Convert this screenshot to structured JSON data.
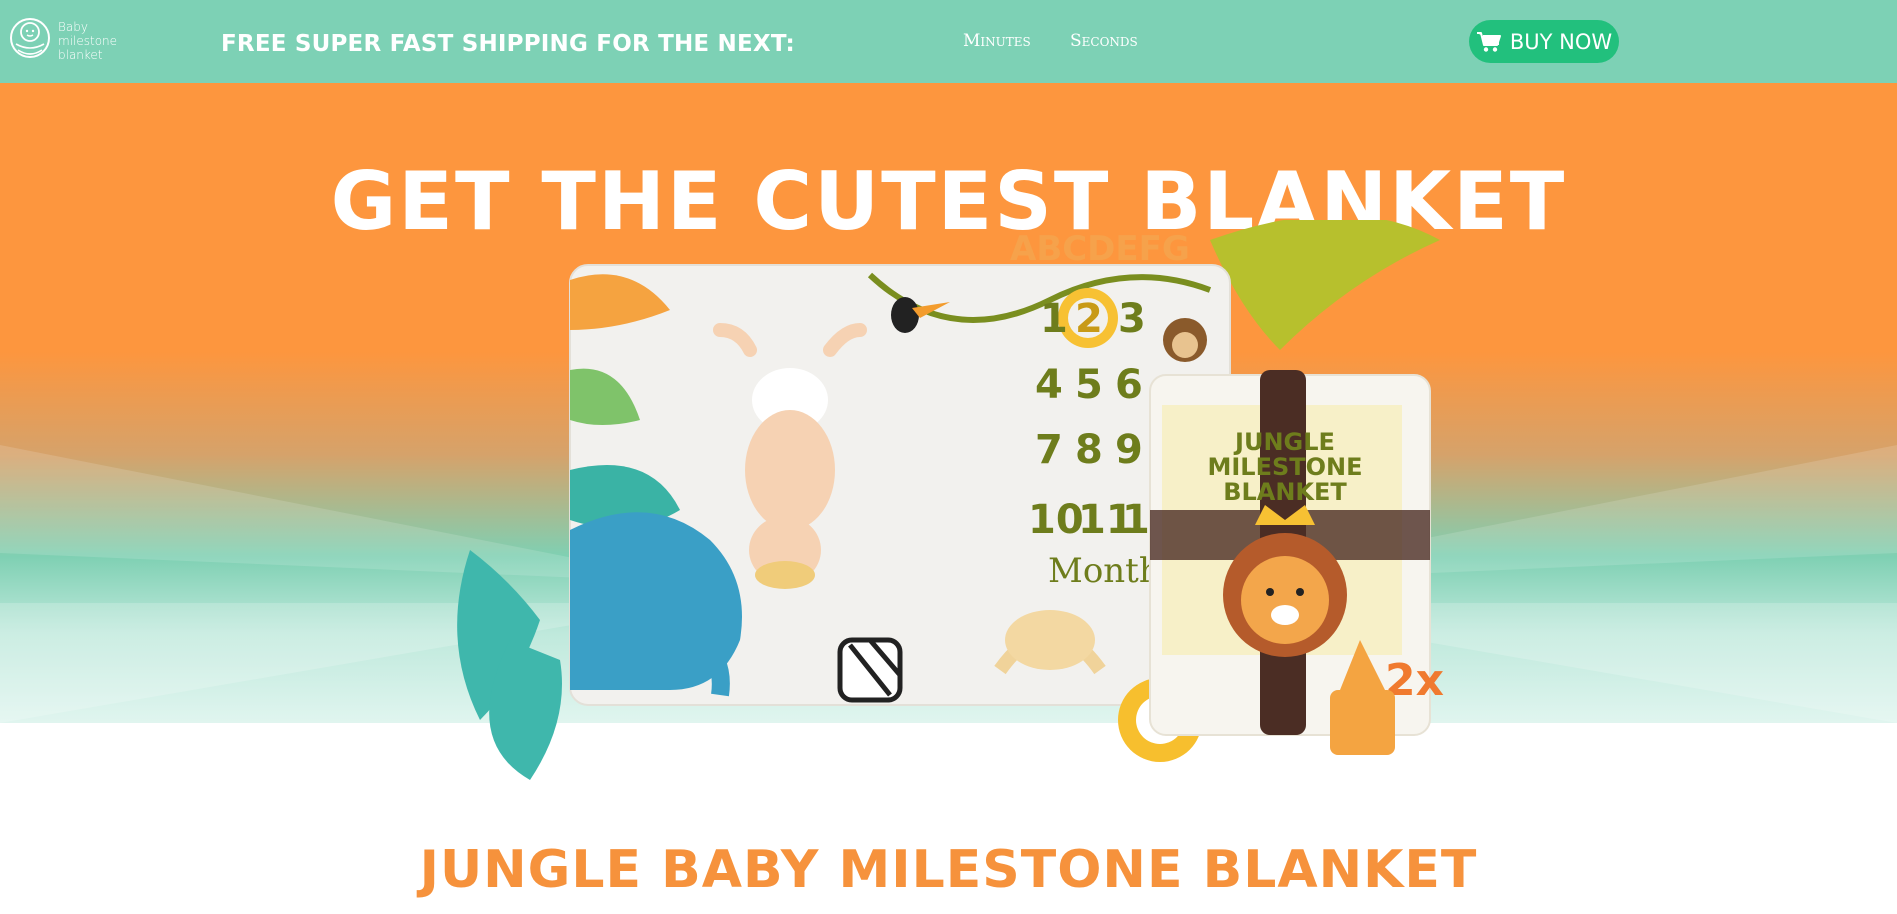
{
  "header": {
    "logo": {
      "line1": "Baby",
      "line2": "milestone",
      "line3": "blanket"
    },
    "promo_text": "FREE SUPER FAST SHIPPING FOR THE NEXT:",
    "timer": {
      "minutes_label": "Minutes",
      "seconds_label": "Seconds"
    },
    "buy_button": {
      "label": "BUY NOW",
      "icon": "cart-icon"
    }
  },
  "hero": {
    "title": "GET THE CUTEST BLANKET",
    "image": {
      "blanket_letters": "ABCDEFG",
      "numbers": [
        "1",
        "2",
        "3",
        "4",
        "5",
        "6",
        "7",
        "8",
        "9",
        "10",
        "11",
        "12"
      ],
      "months_label": "Months",
      "package_title_1": "JUNGLE",
      "package_title_2": "MILESTONE",
      "package_title_3": "BLANKET",
      "badge": "2x"
    }
  },
  "product": {
    "title": "JUNGLE BABY MILESTONE BLANKET"
  },
  "colors": {
    "header_bg": "#7dd1b5",
    "hero_orange": "#fd963e",
    "button_green": "#22c07d",
    "product_title": "#f6923c"
  }
}
